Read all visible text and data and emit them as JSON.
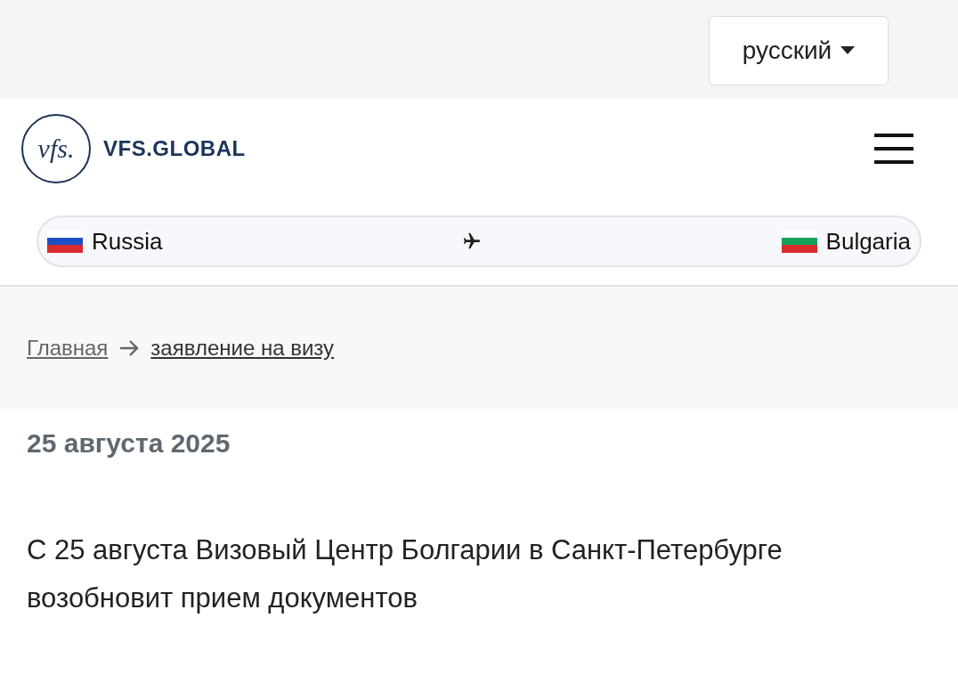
{
  "language_button": {
    "label": "русский"
  },
  "logo": {
    "mark": "vfs.",
    "wordmark": "VFS.GLOBAL"
  },
  "route": {
    "from": "Russia",
    "to": "Bulgaria"
  },
  "breadcrumbs": [
    {
      "label": "Главная"
    },
    {
      "label": "заявление на визу"
    }
  ],
  "article": {
    "date": "25 августа 2025",
    "title": "С 25 августа Визовый Центр Болгарии в Санкт-Петербурге возобновит прием документов"
  }
}
